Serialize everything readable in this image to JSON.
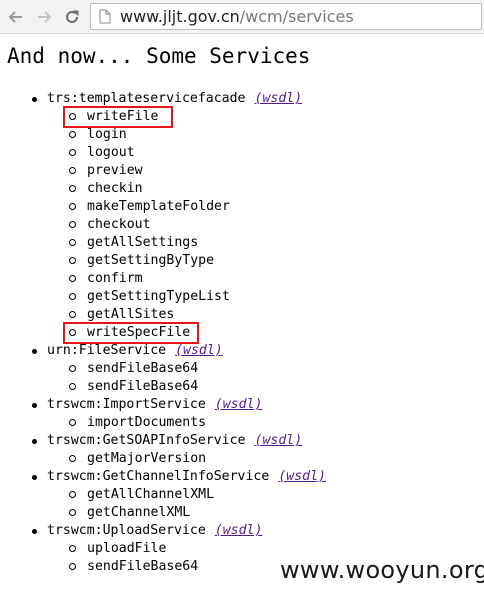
{
  "browser": {
    "url_host": "www.jljt.gov.cn",
    "url_path": "/wcm/services"
  },
  "page": {
    "heading": "And now... Some Services",
    "wsdl_label": "(wsdl)",
    "services": [
      {
        "name": "trs:templateservicefacade",
        "operations": [
          "writeFile",
          "login",
          "logout",
          "preview",
          "checkin",
          "makeTemplateFolder",
          "checkout",
          "getAllSettings",
          "getSettingByType",
          "confirm",
          "getSettingTypeList",
          "getAllSites",
          "writeSpecFile"
        ]
      },
      {
        "name": "urn:FileService",
        "operations": [
          "sendFileBase64",
          "sendFileBase64"
        ]
      },
      {
        "name": "trswcm:ImportService",
        "operations": [
          "importDocuments"
        ]
      },
      {
        "name": "trswcm:GetSOAPInfoService",
        "operations": [
          "getMajorVersion"
        ]
      },
      {
        "name": "trswcm:GetChannelInfoService",
        "operations": [
          "getAllChannelXML",
          "getChannelXML"
        ]
      },
      {
        "name": "trswcm:UploadService",
        "operations": [
          "uploadFile",
          "sendFileBase64"
        ]
      }
    ]
  },
  "watermark": "www.wooyun.org",
  "colors": {
    "highlight": "#e8141b",
    "link_visited": "#551a8b"
  }
}
